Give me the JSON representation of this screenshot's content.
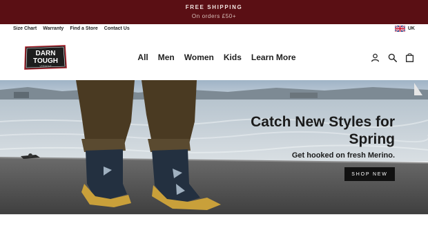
{
  "announcement": {
    "title": "FREE SHIPPING",
    "subtitle": "On orders £50+"
  },
  "utility_nav": {
    "links": [
      "Size Chart",
      "Warranty",
      "Find a Store",
      "Contact Us"
    ],
    "region_label": "UK",
    "region_flag_icon": "uk-flag-icon"
  },
  "header": {
    "logo_lines": [
      "DARN",
      "TOUGH",
      "VERMONT"
    ],
    "nav": [
      "All",
      "Men",
      "Women",
      "Kids",
      "Learn More"
    ],
    "icons": [
      "account-icon",
      "search-icon",
      "cart-icon"
    ]
  },
  "hero": {
    "title": "Catch New Styles for Spring",
    "subtitle": "Get hooked on fresh Merino.",
    "cta": "SHOP NEW"
  },
  "colors": {
    "announcement_bg": "#5a0f14",
    "cta_bg": "#111111",
    "sock_navy": "#233040",
    "sock_mustard": "#c9a03a"
  }
}
